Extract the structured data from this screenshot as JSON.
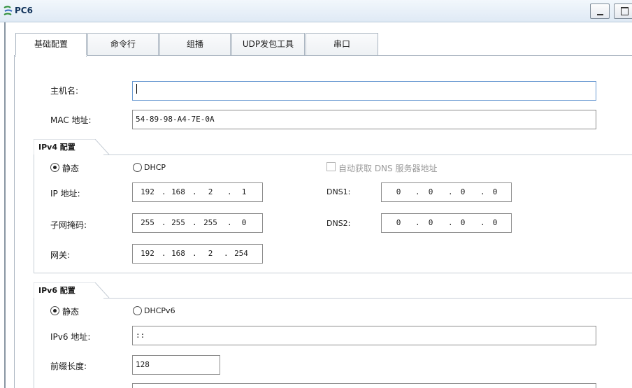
{
  "window": {
    "title": "PC6"
  },
  "tabs": [
    "基础配置",
    "命令行",
    "组播",
    "UDP发包工具",
    "串口"
  ],
  "hostname": {
    "label": "主机名:",
    "value": ""
  },
  "mac": {
    "label": "MAC 地址:",
    "value": "54-89-98-A4-7E-0A"
  },
  "ipv4": {
    "group_label": "IPv4 配置",
    "static_label": "静态",
    "dhcp_label": "DHCP",
    "mode": "static",
    "auto_dns_label": "自动获取 DNS 服务器地址",
    "ip_label": "IP 地址:",
    "ip": [
      "192",
      "168",
      "2",
      "1"
    ],
    "mask_label": "子网掩码:",
    "mask": [
      "255",
      "255",
      "255",
      "0"
    ],
    "gateway_label": "网关:",
    "gateway": [
      "192",
      "168",
      "2",
      "254"
    ],
    "dns1_label": "DNS1:",
    "dns1": [
      "0",
      "0",
      "0",
      "0"
    ],
    "dns2_label": "DNS2:",
    "dns2": [
      "0",
      "0",
      "0",
      "0"
    ]
  },
  "ipv6": {
    "group_label": "IPv6 配置",
    "static_label": "静态",
    "dhcp_label": "DHCPv6",
    "mode": "static",
    "ip_label": "IPv6 地址:",
    "ip_value": "::",
    "prefix_label": "前缀长度:",
    "prefix_value": "128"
  }
}
